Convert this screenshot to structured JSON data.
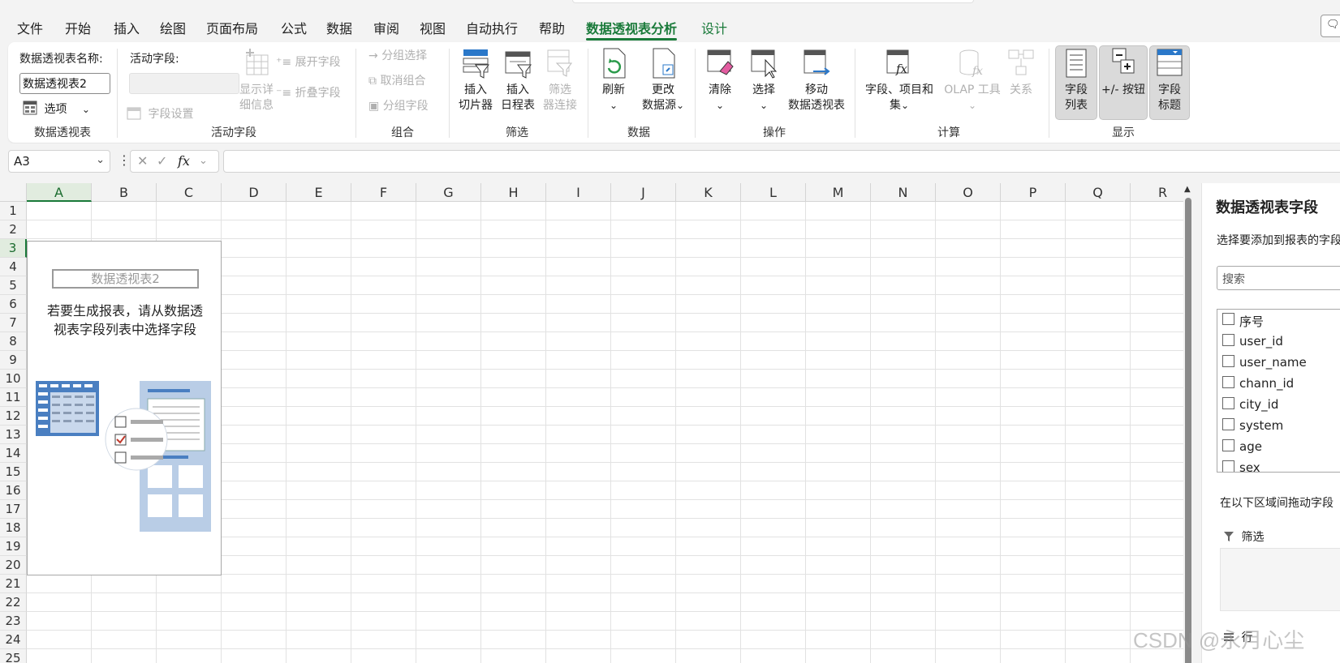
{
  "menu": {
    "tabs": [
      "文件",
      "开始",
      "插入",
      "绘图",
      "页面布局",
      "公式",
      "数据",
      "审阅",
      "视图",
      "自动执行",
      "帮助",
      "数据透视表分析",
      "设计"
    ],
    "active_tab": "数据透视表分析"
  },
  "ribbon": {
    "pivottable": {
      "name_label": "数据透视表名称:",
      "name_value": "数据透视表2",
      "options_label": "选项",
      "group_label": "数据透视表"
    },
    "active_field": {
      "label": "活动字段:",
      "field_settings": "字段设置",
      "drill_line1": "显示详",
      "drill_line2": "细信息",
      "expand": "展开字段",
      "collapse": "折叠字段",
      "group_label": "活动字段"
    },
    "group": {
      "group_selection": "分组选择",
      "ungroup": "取消组合",
      "group_field": "分组字段",
      "group_label": "组合"
    },
    "filter": {
      "slicer_line1": "插入",
      "slicer_line2": "切片器",
      "timeline_line1": "插入",
      "timeline_line2": "日程表",
      "filter_conn_line1": "筛选",
      "filter_conn_line2": "器连接",
      "group_label": "筛选"
    },
    "data": {
      "refresh": "刷新",
      "change_line1": "更改",
      "change_line2": "数据源",
      "group_label": "数据"
    },
    "actions": {
      "clear": "清除",
      "select": "选择",
      "move_line1": "移动",
      "move_line2": "数据透视表",
      "group_label": "操作"
    },
    "calculations": {
      "fields_line1": "字段、项目和",
      "fields_line2": "集",
      "olap": "OLAP 工具",
      "relationships": "关系",
      "group_label": "计算"
    },
    "show": {
      "field_list_line1": "字段",
      "field_list_line2": "列表",
      "buttons": "+/- 按钮",
      "headers_line1": "字段",
      "headers_line2": "标题",
      "group_label": "显示"
    }
  },
  "formula_bar": {
    "name_box": "A3",
    "fx": "fx",
    "value": ""
  },
  "sheet": {
    "columns": [
      "A",
      "B",
      "C",
      "D",
      "E",
      "F",
      "G",
      "H",
      "I",
      "J",
      "K",
      "L",
      "M",
      "N",
      "O",
      "P",
      "Q",
      "R"
    ],
    "rows": [
      "1",
      "2",
      "3",
      "4",
      "5",
      "6",
      "7",
      "8",
      "9",
      "10",
      "11",
      "12",
      "13",
      "14",
      "15",
      "16",
      "17",
      "18",
      "19",
      "20",
      "21",
      "22",
      "23",
      "24",
      "25"
    ],
    "active_cell": "A3"
  },
  "pivot_placeholder": {
    "title": "数据透视表2",
    "line1": "若要生成报表，请从数据透",
    "line2": "视表字段列表中选择字段"
  },
  "field_pane": {
    "title": "数据透视表字段",
    "subtitle": "选择要添加到报表的字段",
    "search_placeholder": "搜索",
    "fields": [
      "序号",
      "user_id",
      "user_name",
      "chann_id",
      "city_id",
      "system",
      "age",
      "sex"
    ],
    "drag_hint": "在以下区域间拖动字段",
    "filter_area": "筛选",
    "row_area": "行"
  },
  "watermark": "CSDN @永月心尘",
  "colors": {
    "accent": "#1a7a3a"
  }
}
